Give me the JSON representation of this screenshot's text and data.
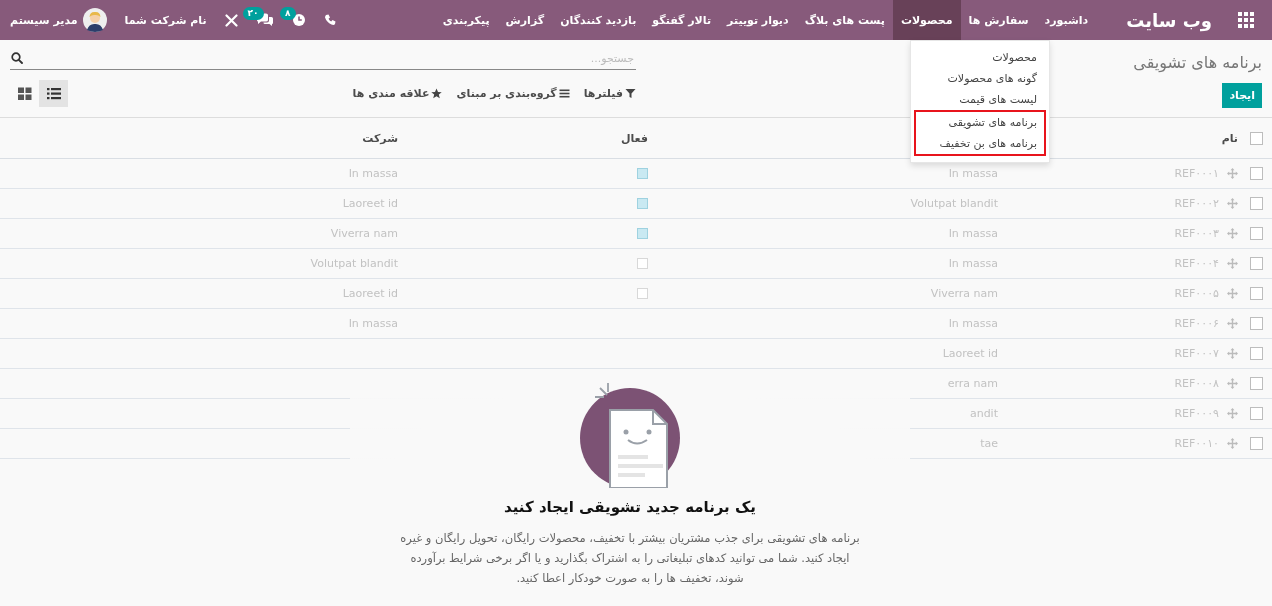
{
  "navbar": {
    "brand": "وب سایت",
    "menu": [
      {
        "label": "داشبورد",
        "selected": false
      },
      {
        "label": "سفارش ها",
        "selected": false
      },
      {
        "label": "محصولات",
        "selected": true
      },
      {
        "label": "پست های بلاگ",
        "selected": false
      },
      {
        "label": "دیوار توییتر",
        "selected": false
      },
      {
        "label": "تالار گفتگو",
        "selected": false
      },
      {
        "label": "بازدید کنندگان",
        "selected": false
      },
      {
        "label": "گزارش",
        "selected": false
      },
      {
        "label": "پیکربندی",
        "selected": false
      }
    ],
    "systray": {
      "activity_count": "۸",
      "message_count": "۲۰",
      "company": "نام شرکت شما",
      "user": "مدیر سیستم"
    }
  },
  "dropdown": {
    "items": [
      {
        "label": "محصولات",
        "highlighted": false
      },
      {
        "label": "گونه های محصولات",
        "highlighted": false
      },
      {
        "label": "لیست های قیمت",
        "highlighted": false
      },
      {
        "label": "برنامه های تشویقی",
        "highlighted": true
      },
      {
        "label": "برنامه های بن تخفیف",
        "highlighted": true
      }
    ]
  },
  "control_panel": {
    "title": "برنامه های تشویقی",
    "create_button": "ایجاد",
    "search": {
      "placeholder": "جستجو..."
    },
    "filters": [
      {
        "kind": "filter",
        "label": "فیلترها"
      },
      {
        "kind": "group",
        "label": "گروه‌بندی بر مبنای"
      },
      {
        "kind": "favorite",
        "label": "علاقه مندی ها"
      }
    ],
    "views": [
      {
        "kind": "list",
        "selected": true
      },
      {
        "kind": "kanban",
        "selected": false
      }
    ]
  },
  "table": {
    "select_all": false,
    "columns": {
      "reference": "نام",
      "active": "فعال",
      "company": "شرکت"
    },
    "rows": [
      {
        "selected": false,
        "reference": "REF۰۰۰۱",
        "name": "In massa",
        "active": true,
        "company": "In massa"
      },
      {
        "selected": false,
        "reference": "REF۰۰۰۲",
        "name": "Volutpat blandit",
        "active": true,
        "company": "Laoreet id"
      },
      {
        "selected": false,
        "reference": "REF۰۰۰۳",
        "name": "In massa",
        "active": true,
        "company": "Viverra nam"
      },
      {
        "selected": false,
        "reference": "REF۰۰۰۴",
        "name": "In massa",
        "active": false,
        "company": "Volutpat blandit"
      },
      {
        "selected": false,
        "reference": "REF۰۰۰۵",
        "name": "Viverra nam",
        "active": false,
        "company": "Laoreet id"
      },
      {
        "selected": false,
        "reference": "REF۰۰۰۶",
        "name": "In massa",
        "company": "In massa"
      },
      {
        "selected": false,
        "reference": "REF۰۰۰۷",
        "name": "Laoreet id"
      },
      {
        "selected": false,
        "reference": "REF۰۰۰۸",
        "name": "erra nam"
      },
      {
        "selected": false,
        "reference": "REF۰۰۰۹",
        "name": "andit"
      },
      {
        "selected": false,
        "reference": "REF۰۰۱۰",
        "name": "tae"
      }
    ]
  },
  "helper": {
    "title": "یک برنامه جدید تشویقی ایجاد کنید",
    "text": "برنامه های تشویقی برای جذب مشتریان بیشتر با تخفیف، محصولات رایگان، تحویل رایگان و غیره ایجاد کنید. شما می توانید کدهای تبلیغاتی را به اشتراک بگذارید و یا اگر برخی شرایط برآورده شوند، تخفیف ها را به صورت خودکار اعطا کنید."
  }
}
